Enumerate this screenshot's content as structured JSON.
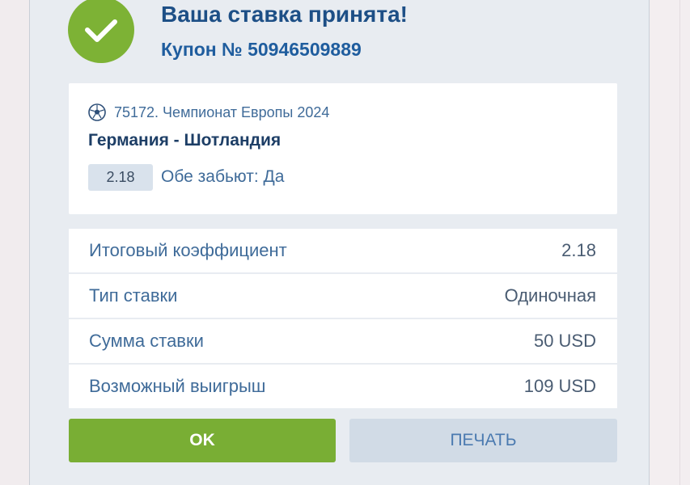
{
  "header": {
    "title": "Ваша ставка принята!",
    "coupon": "Купон № 50946509889"
  },
  "event": {
    "tournament": "75172. Чемпионат Европы 2024",
    "match": "Германия - Шотландия",
    "odds": "2.18",
    "selection": "Обе забьют: Да",
    "sport_icon": "soccer-ball-icon"
  },
  "summary": [
    {
      "label": "Итоговый коэффициент",
      "value": "2.18"
    },
    {
      "label": "Тип ставки",
      "value": "Одиночная"
    },
    {
      "label": "Сумма ставки",
      "value": "50 USD"
    },
    {
      "label": "Возможный выигрыш",
      "value": "109 USD"
    }
  ],
  "buttons": {
    "ok": "OK",
    "print": "ПЕЧАТЬ"
  },
  "colors": {
    "accent_green": "#79ae34",
    "title_blue": "#1d4f86",
    "panel_bg": "#e8ecf1"
  }
}
